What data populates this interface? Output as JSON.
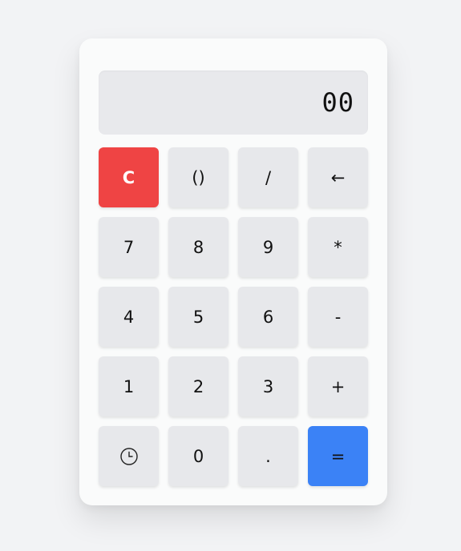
{
  "display": {
    "value": "00"
  },
  "keys": {
    "clear": "C",
    "parens": "()",
    "divide": "/",
    "backspace": "←",
    "seven": "7",
    "eight": "8",
    "nine": "9",
    "multiply": "*",
    "four": "4",
    "five": "5",
    "six": "6",
    "subtract": "-",
    "one": "1",
    "two": "2",
    "three": "3",
    "add": "+",
    "history_icon": "clock-icon",
    "zero": "0",
    "decimal": ".",
    "equals": "="
  },
  "colors": {
    "clear": "#ef4444",
    "equals": "#3b82f6",
    "key": "#e7e8eb",
    "display": "#e8e9ec"
  }
}
